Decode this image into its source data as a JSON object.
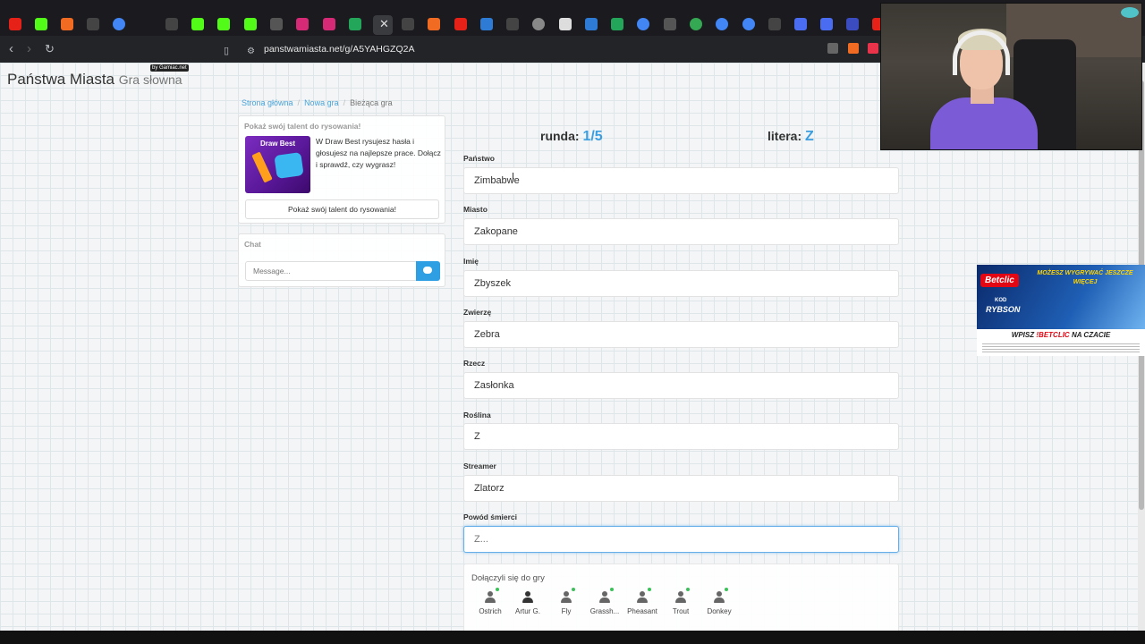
{
  "browser": {
    "url": "panstwamiasta.net/g/A5YAHGZQ2A",
    "tabs": [
      {
        "icon": "youtube-icon",
        "color": "#e62117"
      },
      {
        "icon": "kick-icon",
        "color": "#53fc18"
      },
      {
        "icon": "home-icon",
        "color": "#f26b22"
      },
      {
        "icon": "tiktok-icon",
        "color": "#dddddd"
      },
      {
        "icon": "google-icon",
        "color": "#4285f4"
      },
      {
        "icon": "tiktok-icon",
        "color": "#dddddd"
      },
      {
        "icon": "kick-icon",
        "color": "#53fc18"
      },
      {
        "icon": "kick-icon",
        "color": "#53fc18"
      },
      {
        "icon": "kick-icon",
        "color": "#53fc18"
      },
      {
        "icon": "x-icon",
        "color": "#dddddd"
      },
      {
        "icon": "instagram-icon",
        "color": "#d62976"
      },
      {
        "icon": "instagram-icon",
        "color": "#d62976"
      },
      {
        "icon": "site-icon",
        "color": "#23a55a"
      }
    ]
  },
  "brand": {
    "title": "Państwa Miasta",
    "subtitle": "Gra słowna",
    "tag": "by Gamiac.net"
  },
  "breadcrumb": {
    "home": "Strona główna",
    "new_game": "Nowa gra",
    "current": "Bieżąca gra"
  },
  "promo": {
    "title": "Pokaż swój talent do rysowania!",
    "image_title": "Draw Best",
    "text": "W Draw Best rysujesz hasła i głosujesz na najlepsze prace. Dołącz i sprawdź, czy wygrasz!",
    "button": "Pokaż swój talent do rysowania!"
  },
  "chat": {
    "title": "Chat",
    "placeholder": "Message..."
  },
  "game": {
    "round_label": "runda:",
    "round_value": "1/5",
    "letter_label": "litera:",
    "letter_value": "Z"
  },
  "fields": {
    "panstwo": {
      "label": "Państwo",
      "value": "Zimbabwe"
    },
    "miasto": {
      "label": "Miasto",
      "value": "Zakopane"
    },
    "imie": {
      "label": "Imię",
      "value": "Zbyszek"
    },
    "zwierze": {
      "label": "Zwierzę",
      "value": "Zebra"
    },
    "rzecz": {
      "label": "Rzecz",
      "value": "Zasłonka"
    },
    "roslina": {
      "label": "Roślina",
      "value": "Z"
    },
    "streamer": {
      "label": "Streamer",
      "value": "Zlatorz"
    },
    "powod": {
      "label": "Powód śmierci",
      "placeholder": "Z..."
    }
  },
  "joined": {
    "title": "Dołączyli się do gry",
    "players": [
      "Ostrich",
      "Artur G.",
      "Fly",
      "Grassh...",
      "Pheasant",
      "Trout",
      "Donkey"
    ]
  },
  "ad": {
    "brand": "Betclic",
    "headline": "MOŻESZ WYGRYWAĆ JESZCZE WIĘCEJ",
    "code_label": "KOD",
    "code": "RYBSON",
    "footer_prefix": "WPISZ",
    "footer_code": "!BETCLIC",
    "footer_suffix": "NA CZACIE"
  }
}
